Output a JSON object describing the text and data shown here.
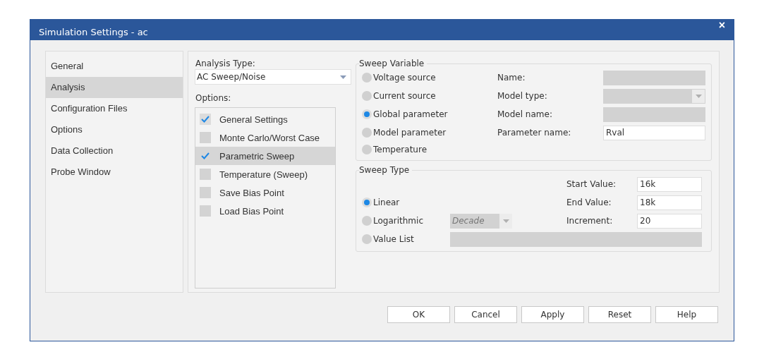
{
  "window": {
    "title": "Simulation Settings - ac",
    "close": "×"
  },
  "sidebar": {
    "items": [
      {
        "label": "General",
        "selected": false
      },
      {
        "label": "Analysis",
        "selected": true
      },
      {
        "label": "Configuration Files",
        "selected": false
      },
      {
        "label": "Options",
        "selected": false
      },
      {
        "label": "Data Collection",
        "selected": false
      },
      {
        "label": "Probe Window",
        "selected": false
      }
    ]
  },
  "analysis_type": {
    "label": "Analysis Type:",
    "value": "AC Sweep/Noise"
  },
  "options": {
    "label": "Options:",
    "items": [
      {
        "label": "General Settings",
        "checked": true,
        "selected": false
      },
      {
        "label": "Monte Carlo/Worst Case",
        "checked": false,
        "selected": false
      },
      {
        "label": "Parametric Sweep",
        "checked": true,
        "selected": true
      },
      {
        "label": "Temperature (Sweep)",
        "checked": false,
        "selected": false
      },
      {
        "label": "Save Bias Point",
        "checked": false,
        "selected": false
      },
      {
        "label": "Load Bias Point",
        "checked": false,
        "selected": false
      }
    ]
  },
  "sweep_variable": {
    "title": "Sweep Variable",
    "radios": [
      {
        "label": "Voltage source",
        "selected": false
      },
      {
        "label": "Current source",
        "selected": false
      },
      {
        "label": "Global parameter",
        "selected": true
      },
      {
        "label": "Model parameter",
        "selected": false
      },
      {
        "label": "Temperature",
        "selected": false
      }
    ],
    "fields": [
      {
        "label": "Name:",
        "kind": "text",
        "disabled": true
      },
      {
        "label": "Model type:",
        "kind": "select",
        "disabled": true
      },
      {
        "label": "Model name:",
        "kind": "text",
        "disabled": true
      },
      {
        "label": "Parameter name:",
        "kind": "text",
        "disabled": false,
        "value": "Rval"
      }
    ]
  },
  "sweep_type": {
    "title": "Sweep Type",
    "radios": [
      {
        "label": "Linear",
        "selected": true
      },
      {
        "label": "Logarithmic",
        "selected": false
      },
      {
        "label": "Value List",
        "selected": false
      }
    ],
    "log_scale": {
      "value": "Decade",
      "disabled": true
    },
    "value_list": {
      "disabled": true
    },
    "values": [
      {
        "label": "Start Value:",
        "value": "16k"
      },
      {
        "label": "End Value:",
        "value": "18k"
      },
      {
        "label": "Increment:",
        "value": "20"
      }
    ]
  },
  "buttons": [
    "OK",
    "Cancel",
    "Apply",
    "Reset",
    "Help"
  ]
}
